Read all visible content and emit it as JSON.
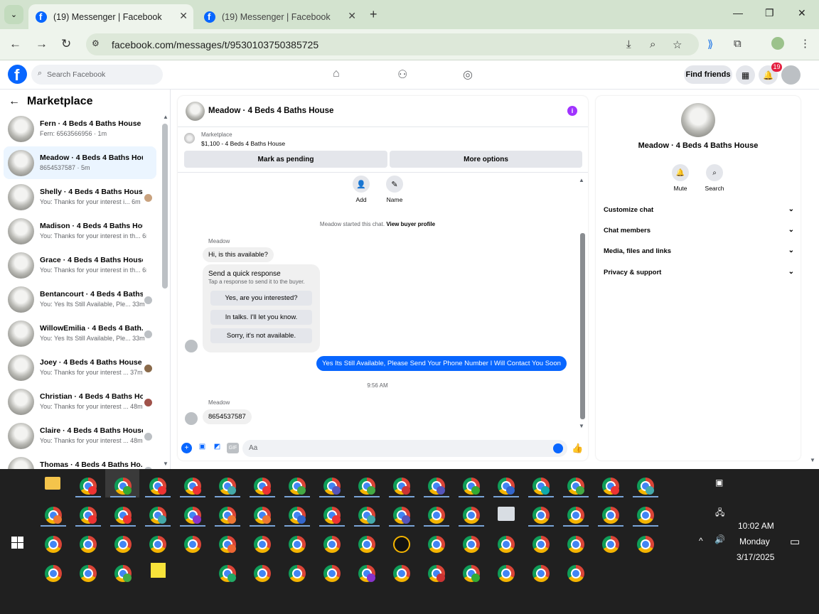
{
  "browser": {
    "tabs": [
      {
        "title": "(19) Messenger | Facebook",
        "active": true
      },
      {
        "title": "(19) Messenger | Facebook",
        "active": false
      }
    ],
    "url": "facebook.com/messages/t/9530103750385725",
    "colors": {
      "chrome": "#d3e3cf",
      "toolbar": "#eef4ec"
    }
  },
  "fb": {
    "search_placeholder": "Search Facebook",
    "find_friends": "Find friends",
    "notification_count": "19",
    "brand_color": "#0866ff"
  },
  "sidebar": {
    "title": "Marketplace",
    "conversations": [
      {
        "name": "Fern · 4 Beds 4 Baths House",
        "sub": "Fern: 6563566956 · 1m",
        "selected": false
      },
      {
        "name": "Meadow · 4 Beds 4 Baths House",
        "sub": "8654537587 · 5m",
        "selected": true
      },
      {
        "name": "Shelly · 4 Beds 4 Baths House",
        "sub": "You: Thanks for your interest i...  6m",
        "selected": false
      },
      {
        "name": "Madison · 4 Beds 4 Baths House",
        "sub": "You: Thanks for your interest in th... 6m",
        "selected": false
      },
      {
        "name": "Grace · 4 Beds 4 Baths House",
        "sub": "You: Thanks for your interest in th... 6m",
        "selected": false
      },
      {
        "name": "Bentancourt · 4 Beds 4 Baths...",
        "sub": "You: Yes Its Still Available, Ple... 33m",
        "selected": false
      },
      {
        "name": "WillowEmilia · 4 Beds 4 Bath...",
        "sub": "You: Yes Its Still Available, Ple... 33m",
        "selected": false
      },
      {
        "name": "Joey · 4 Beds 4 Baths House",
        "sub": "You: Thanks for your interest ... 37m",
        "selected": false
      },
      {
        "name": "Christian · 4 Beds 4 Baths Ho...",
        "sub": "You: Thanks for your interest ... 48m",
        "selected": false
      },
      {
        "name": "Claire · 4 Beds 4 Baths House",
        "sub": "You: Thanks for your interest ... 48m",
        "selected": false
      },
      {
        "name": "Thomas · 4 Beds 4 Baths Ho...",
        "sub": "",
        "selected": false
      }
    ]
  },
  "chat": {
    "title": "Meadow · 4 Beds 4 Baths House",
    "marketplace_label": "Marketplace",
    "listing": "$1,100 - 4 Beds 4 Baths House",
    "mark_pending": "Mark as pending",
    "more_options": "More options",
    "add_label": "Add",
    "name_label": "Name",
    "started_text": "Meadow started this chat.",
    "view_profile": "View buyer profile",
    "sender": "Meadow",
    "msg1": "Hi, is this available?",
    "quick_title": "Send a quick response",
    "quick_sub": "Tap a response to send it to the buyer.",
    "quick_options": [
      "Yes, are you interested?",
      "In talks. I'll let you know.",
      "Sorry, it's not available."
    ],
    "outgoing": "Yes Its Still Available, Please Send Your Phone Number I Will Contact You Soon",
    "time": "9:56 AM",
    "sender2": "Meadow",
    "msg2": "8654537587",
    "composer_placeholder": "Aa",
    "gif_label": "GIF"
  },
  "details": {
    "title": "Meadow · 4 Beds 4 Baths House",
    "mute": "Mute",
    "search": "Search",
    "sections": [
      "Customize chat",
      "Chat members",
      "Media, files and links",
      "Privacy & support"
    ]
  },
  "taskbar": {
    "time": "10:02 AM",
    "day": "Monday",
    "date": "3/17/2025"
  }
}
